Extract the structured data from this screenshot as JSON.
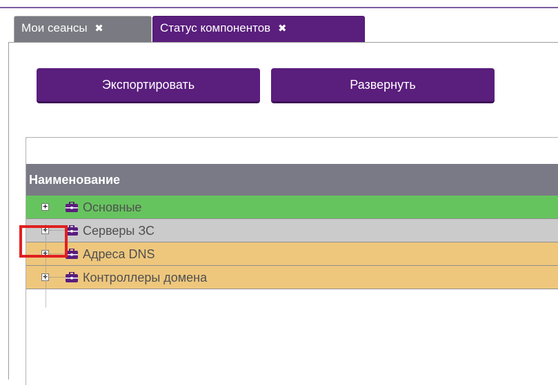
{
  "tabs": [
    {
      "label": "Мои сеансы",
      "active": false
    },
    {
      "label": "Статус компонентов",
      "active": true
    }
  ],
  "toolbar": {
    "export_label": "Экспортировать",
    "expand_label": "Развернуть"
  },
  "grid": {
    "header": "Наименование",
    "rows": [
      {
        "label": "Основные",
        "color": "#66c45e",
        "expander": "+"
      },
      {
        "label": "Серверы ЗС",
        "color": "#cbcbcb",
        "expander": "+"
      },
      {
        "label": "Адреса DNS",
        "color": "#eec77d",
        "expander": "+"
      },
      {
        "label": "Контроллеры домена",
        "color": "#eec77d",
        "expander": "+"
      }
    ]
  },
  "colors": {
    "accent": "#5a1e7d",
    "highlight": "#e02020"
  },
  "icons": {
    "tab_close": "close-icon",
    "row_icon": "briefcase-icon"
  }
}
